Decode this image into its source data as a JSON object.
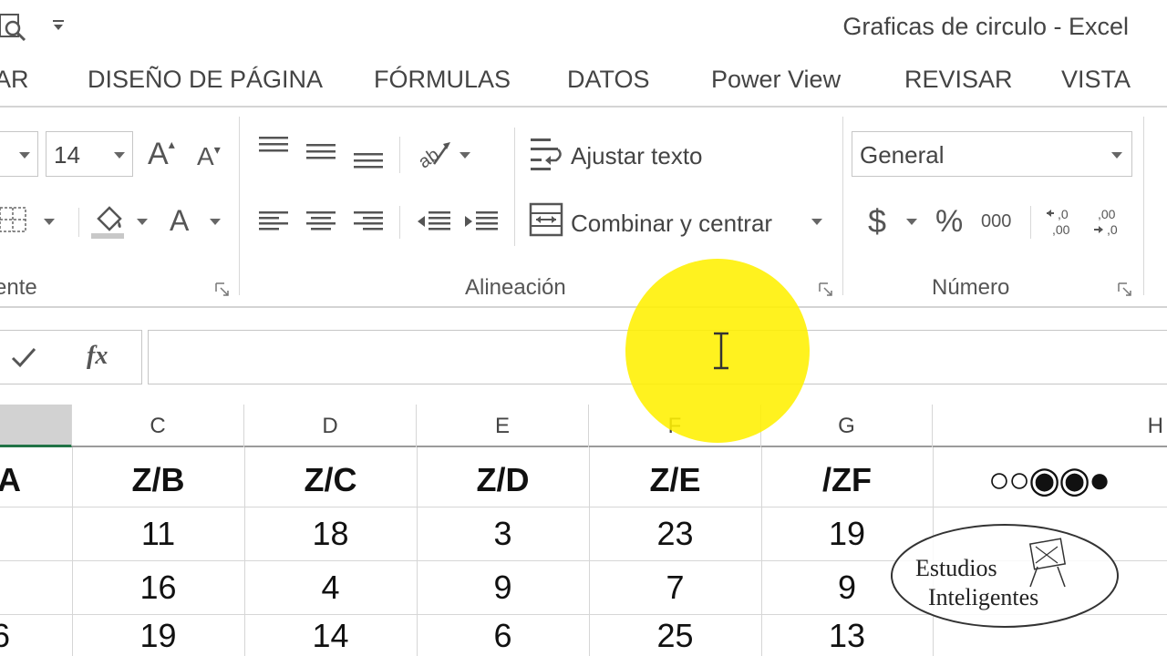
{
  "window": {
    "title": "Graficas de circulo - Excel"
  },
  "ribbon_tabs": [
    "AR",
    "DISEÑO DE PÁGINA",
    "FÓRMULAS",
    "DATOS",
    "Power View",
    "REVISAR",
    "VISTA"
  ],
  "font_group": {
    "font_size": "14",
    "label": "ente"
  },
  "alignment_group": {
    "wrap_text": "Ajustar texto",
    "merge_center": "Combinar y centrar",
    "label": "Alineación"
  },
  "number_group": {
    "format": "General",
    "currency": "$",
    "percent": "%",
    "thousands": "000",
    "label": "Número"
  },
  "formula_bar": {
    "fx": "fx",
    "value": ""
  },
  "grid": {
    "column_headers": [
      "",
      "C",
      "D",
      "E",
      "F",
      "G",
      "H"
    ],
    "header_row": [
      "A",
      "Z/B",
      "Z/C",
      "Z/D",
      "Z/E",
      "/ZF"
    ],
    "rows": [
      [
        "",
        "11",
        "18",
        "3",
        "23",
        "19"
      ],
      [
        "",
        "16",
        "4",
        "9",
        "7",
        "9"
      ],
      [
        "6",
        "19",
        "14",
        "6",
        "25",
        "13"
      ]
    ]
  },
  "rating_symbols": "○○◉◉●",
  "watermark": {
    "line1": "Estudios",
    "line2": "Inteligentes"
  },
  "colors": {
    "highlight": "#fff000",
    "excel_green": "#217346"
  }
}
